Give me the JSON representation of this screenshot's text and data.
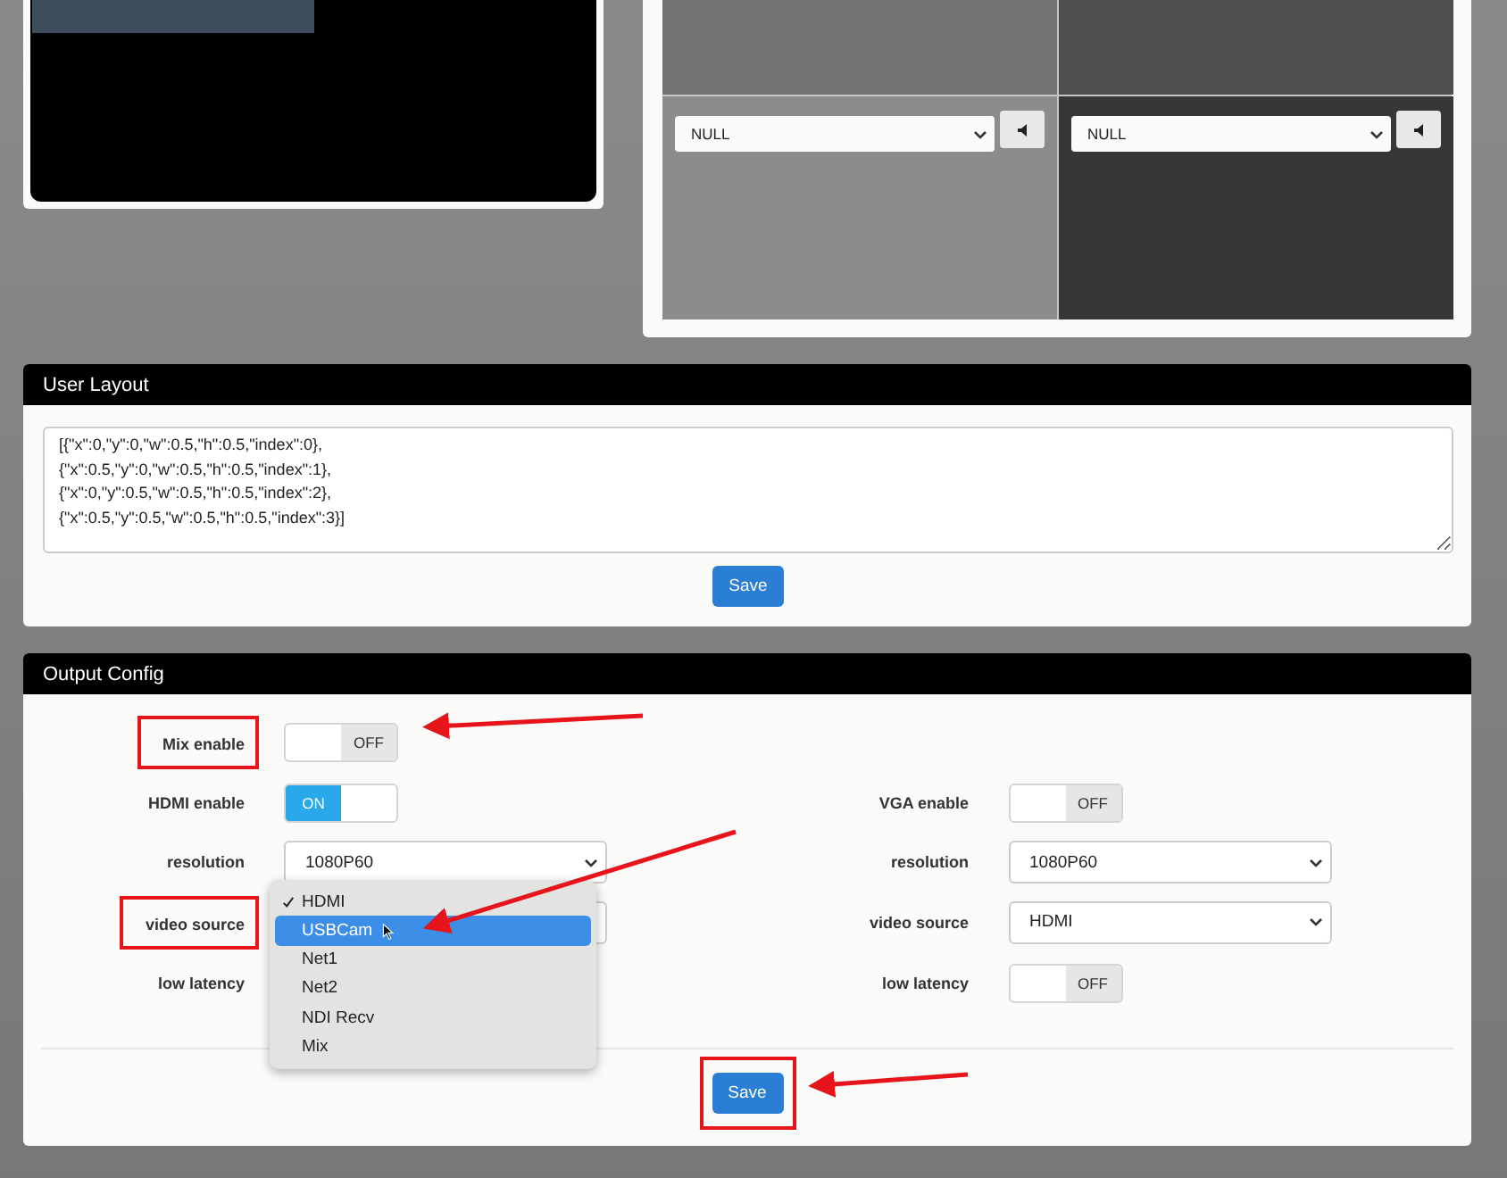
{
  "monitor": {
    "channels": [
      {
        "source": "NULL"
      },
      {
        "source": "NULL"
      }
    ]
  },
  "user_layout": {
    "title": "User Layout",
    "value": "[{\"x\":0,\"y\":0,\"w\":0.5,\"h\":0.5,\"index\":0},\n{\"x\":0.5,\"y\":0,\"w\":0.5,\"h\":0.5,\"index\":1},\n{\"x\":0,\"y\":0.5,\"w\":0.5,\"h\":0.5,\"index\":2},\n{\"x\":0.5,\"y\":0.5,\"w\":0.5,\"h\":0.5,\"index\":3}]",
    "button": "Save"
  },
  "output_config": {
    "title": "Output Config",
    "columns": [
      {
        "rows": [
          {
            "kind": "toggle",
            "label": "Mix enable",
            "on": false,
            "text": "OFF",
            "marked": true
          },
          {
            "kind": "toggle",
            "label": "HDMI enable",
            "on": true,
            "text": "ON"
          },
          {
            "kind": "select",
            "label": "resolution",
            "value": "1080P60"
          },
          {
            "kind": "select",
            "label": "video source",
            "open": true,
            "marked": true,
            "options": [
              {
                "label": "HDMI",
                "checked": true,
                "selected": false
              },
              {
                "label": "USBCam",
                "checked": false,
                "selected": true,
                "pointed": true
              },
              {
                "label": "Net1",
                "checked": false,
                "selected": false
              },
              {
                "label": "Net2",
                "checked": false,
                "selected": false
              },
              {
                "label": "NDI Recv",
                "checked": false,
                "selected": false
              },
              {
                "label": "Mix",
                "checked": false,
                "selected": false
              }
            ]
          },
          {
            "kind": "covered",
            "label": "low latency"
          }
        ]
      },
      {
        "rows": [
          {
            "kind": "blank"
          },
          {
            "kind": "toggle",
            "label": "VGA enable",
            "on": false,
            "text": "OFF"
          },
          {
            "kind": "select",
            "label": "resolution",
            "value": "1080P60"
          },
          {
            "kind": "select",
            "label": "video source",
            "value": "HDMI",
            "open": false
          },
          {
            "kind": "toggle",
            "label": "low latency",
            "on": false,
            "text": "OFF"
          }
        ]
      }
    ],
    "button": "Save",
    "button_marked": true
  }
}
